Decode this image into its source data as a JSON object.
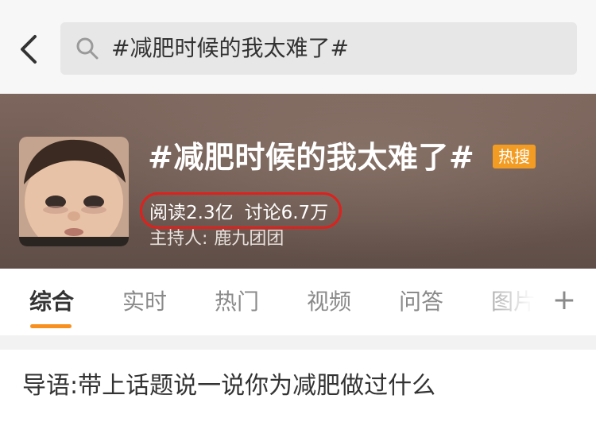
{
  "search": {
    "query": "#减肥时候的我太难了#"
  },
  "topic": {
    "title": "#减肥时候的我太难了#",
    "badge": "热搜",
    "reads": "阅读2.3亿",
    "discussions": "讨论6.7万",
    "host_label": "主持人:",
    "host_name": "鹿九团团"
  },
  "tabs": [
    {
      "label": "综合",
      "active": true
    },
    {
      "label": "实时"
    },
    {
      "label": "热门"
    },
    {
      "label": "视频"
    },
    {
      "label": "问答"
    },
    {
      "label": "图片"
    }
  ],
  "more_tabs": "+",
  "intro": {
    "text": "导语:带上话题说一说你为减肥做过什么"
  },
  "colors": {
    "accent": "#f7901e",
    "hot_badge": "#f39c23",
    "highlight": "#e0201c"
  },
  "icons": {
    "back": "chevron-left-icon",
    "search": "search-icon",
    "add": "plus-icon"
  }
}
